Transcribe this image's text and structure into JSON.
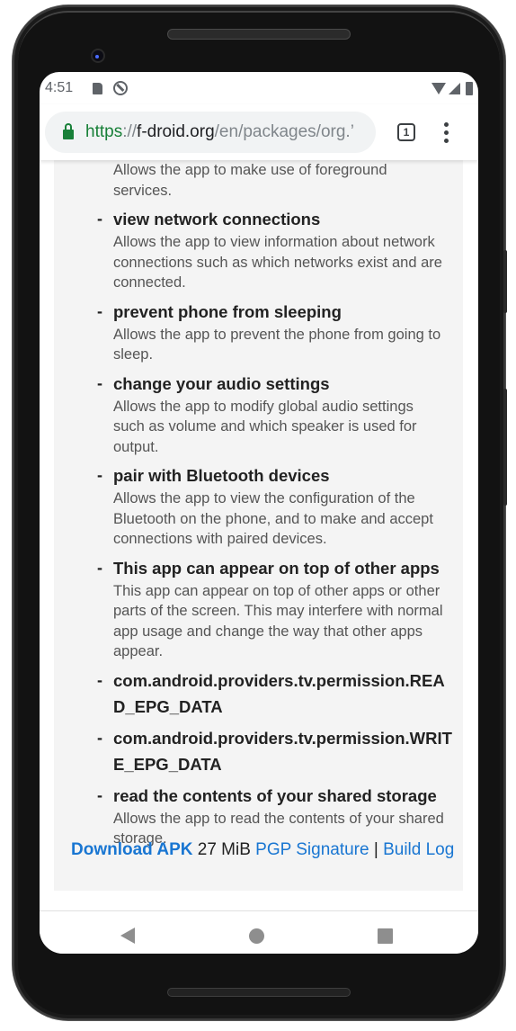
{
  "status_bar": {
    "time": "4:51",
    "left_icons": [
      "sd-card-icon",
      "sync-icon"
    ],
    "right_icons": [
      "wifi-icon",
      "signal-icon",
      "battery-icon"
    ]
  },
  "browser": {
    "url_scheme": "https",
    "url_separator": "://",
    "url_host": "f-droid.org",
    "url_path": "/en/packages/org.’",
    "tab_count": "1"
  },
  "permissions": {
    "leading_description": "Allows the app to make use of foreground services.",
    "items": [
      {
        "title": "view network connections",
        "description": "Allows the app to view information about network connections such as which networks exist and are connected."
      },
      {
        "title": "prevent phone from sleeping",
        "description": "Allows the app to prevent the phone from going to sleep."
      },
      {
        "title": "change your audio settings",
        "description": "Allows the app to modify global audio settings such as volume and which speaker is used for output."
      },
      {
        "title": "pair with Bluetooth devices",
        "description": "Allows the app to view the configuration of the Bluetooth on the phone, and to make and accept connections with paired devices."
      },
      {
        "title": "This app can appear on top of other apps",
        "description": "This app can appear on top of other apps or other parts of the screen. This may interfere with normal app usage and change the way that other apps appear."
      },
      {
        "title": "com.android.providers.tv.permission.READ_EPG_DATA",
        "description": ""
      },
      {
        "title": "com.android.providers.tv.permission.WRITE_EPG_DATA",
        "description": ""
      },
      {
        "title": "read the contents of your shared storage",
        "description": "Allows the app to read the contents of your shared storage."
      }
    ],
    "dash": "-"
  },
  "download": {
    "apk_label": "Download APK",
    "size": "27 MiB",
    "pgp_label": "PGP Signature",
    "separator": "|",
    "build_log_label": "Build Log"
  },
  "colors": {
    "link": "#1976d2",
    "secure_green": "#188038",
    "content_bg": "#f4f4f4"
  }
}
